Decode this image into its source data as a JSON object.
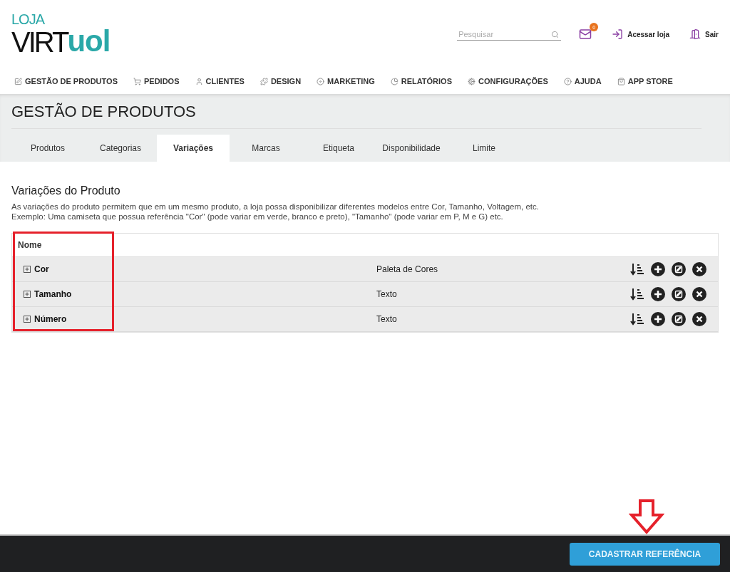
{
  "logo": {
    "top": "LOJA",
    "left": "VIRT",
    "right": "uol"
  },
  "search": {
    "placeholder": "Pesquisar"
  },
  "mail": {
    "badge": "0"
  },
  "header_links": [
    {
      "kind": "store",
      "label": "Acessar loja"
    },
    {
      "kind": "exit",
      "label": "Sair"
    }
  ],
  "nav": [
    {
      "kind": "products",
      "label": "GESTÃO DE PRODUTOS"
    },
    {
      "kind": "cart",
      "label": "PEDIDOS"
    },
    {
      "kind": "user",
      "label": "CLIENTES"
    },
    {
      "kind": "design",
      "label": "DESIGN"
    },
    {
      "kind": "marketing",
      "label": "MARKETING"
    },
    {
      "kind": "reports",
      "label": "RELATÓRIOS"
    },
    {
      "kind": "settings",
      "label": "CONFIGURAÇÕES"
    },
    {
      "kind": "help",
      "label": "AJUDA"
    },
    {
      "kind": "store",
      "label": "APP STORE"
    }
  ],
  "page_title": "GESTÃO DE PRODUTOS",
  "tabs": [
    {
      "label": "Produtos",
      "selected": false
    },
    {
      "label": "Categorias",
      "selected": false
    },
    {
      "label": "Variações",
      "selected": true
    },
    {
      "label": "Marcas",
      "selected": false
    },
    {
      "label": "Etiqueta",
      "selected": false
    },
    {
      "label": "Disponibilidade",
      "selected": false
    },
    {
      "label": "Limite",
      "selected": false
    }
  ],
  "section": {
    "title": "Variações do Produto",
    "lines": [
      "As variações do produto permitem que em um mesmo produto, a loja possa disponibilizar diferentes modelos entre Cor, Tamanho, Voltagem, etc.",
      "Exemplo: Uma camiseta que possua referência \"Cor\" (pode variar em verde, branco e preto), \"Tamanho\" (pode variar em P, M e G) etc."
    ]
  },
  "table": {
    "columns": [
      "Nome"
    ],
    "rows": [
      {
        "name": "Cor",
        "type": "Paleta de Cores",
        "expanded": false
      },
      {
        "name": "Tamanho",
        "type": "Texto",
        "expanded": false
      },
      {
        "name": "Número",
        "type": "Texto",
        "expanded": false
      }
    ]
  },
  "footer": {
    "button": "CADASTRAR REFERÊNCIA"
  }
}
